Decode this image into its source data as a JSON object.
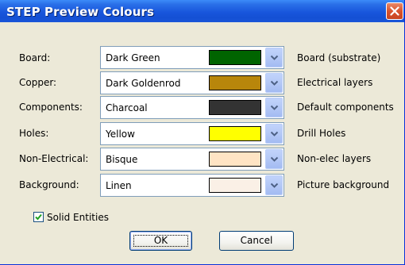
{
  "window": {
    "title": "STEP Preview Colours"
  },
  "rows": [
    {
      "label": "Board:",
      "value": "Dark Green",
      "swatch": "#006400",
      "desc": "Board (substrate)"
    },
    {
      "label": "Copper:",
      "value": "Dark Goldenrod",
      "swatch": "#b8860b",
      "desc": "Electrical layers"
    },
    {
      "label": "Components:",
      "value": "Charcoal",
      "swatch": "#333333",
      "desc": "Default components"
    },
    {
      "label": "Holes:",
      "value": "Yellow",
      "swatch": "#ffff00",
      "desc": "Drill Holes"
    },
    {
      "label": "Non-Electrical:",
      "value": "Bisque",
      "swatch": "#ffe4c4",
      "desc": "Non-elec layers"
    },
    {
      "label": "Background:",
      "value": "Linen",
      "swatch": "#faf0e6",
      "desc": "Picture background"
    }
  ],
  "options": {
    "solid_entities_label": "Solid Entities",
    "solid_entities_checked": true
  },
  "buttons": {
    "ok": "OK",
    "cancel": "Cancel"
  }
}
